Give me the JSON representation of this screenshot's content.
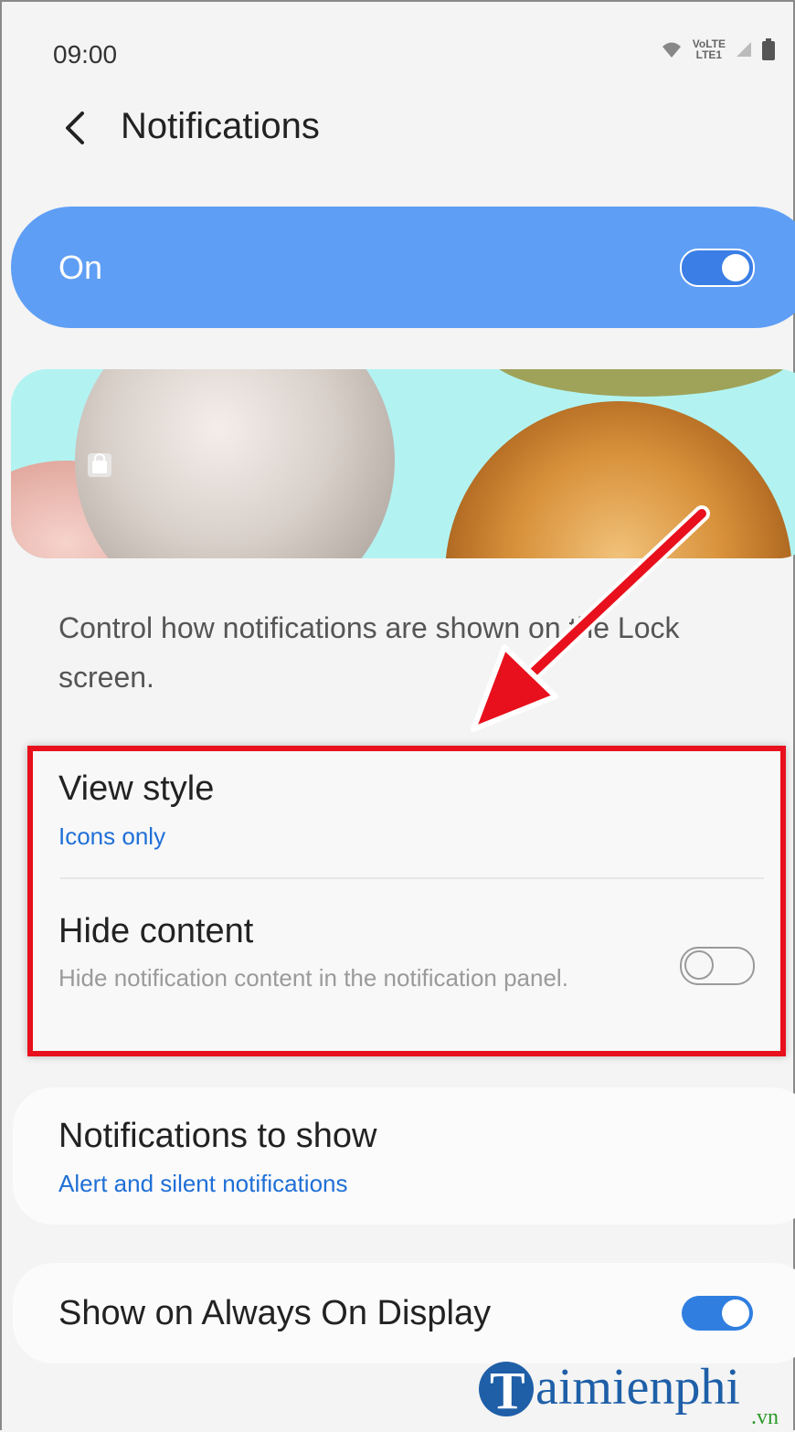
{
  "status_bar": {
    "time": "09:00",
    "volte_line1": "VoLTE",
    "volte_line2": "LTE1"
  },
  "header": {
    "title": "Notifications"
  },
  "master_switch": {
    "label": "On",
    "state": "on"
  },
  "description": "Control how notifications are shown on the Lock screen.",
  "settings": {
    "view_style": {
      "title": "View style",
      "value": "Icons only"
    },
    "hide_content": {
      "title": "Hide content",
      "subtitle": "Hide notification content in the notification panel.",
      "state": "off"
    },
    "notifications_to_show": {
      "title": "Notifications to show",
      "value": "Alert and silent notifications"
    },
    "always_on_display": {
      "title": "Show on Always On Display",
      "state": "on"
    }
  },
  "watermark": {
    "brand": "aimienphi",
    "tld": ".vn",
    "initial": "T"
  },
  "colors": {
    "accent": "#5e9ef5",
    "link_blue": "#1f6fd6",
    "highlight_red": "#e8101c",
    "arrow_red": "#e8101c"
  },
  "icons": [
    "wifi-icon",
    "signal-icon",
    "battery-icon",
    "back-icon",
    "lock-icon"
  ]
}
